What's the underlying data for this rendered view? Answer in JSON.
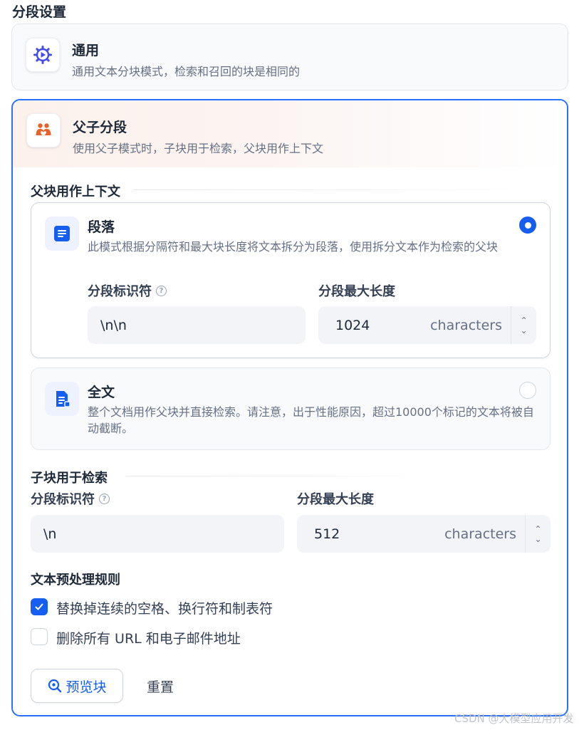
{
  "page": {
    "section_title": "分段设置"
  },
  "general": {
    "title": "通用",
    "desc": "通用文本分块模式，检索和召回的块是相同的",
    "icon": "gear-play-icon",
    "icon_color": "#444ce7"
  },
  "parent_child": {
    "title": "父子分段",
    "desc": "使用父子模式时，子块用于检索，父块用作上下文",
    "icon": "family-icon",
    "icon_color": "#e8622c",
    "border_color": "#2970ff",
    "parent_section": {
      "title": "父块用作上下文",
      "paragraph": {
        "title": "段落",
        "desc": "此模式根据分隔符和最大块长度将文本拆分为段落，使用拆分文本作为检索的父块",
        "selected": true,
        "delimiter_label": "分段标识符",
        "delimiter_value": "\\n\\n",
        "maxlen_label": "分段最大长度",
        "maxlen_value": "1024",
        "maxlen_unit": "characters"
      },
      "full_doc": {
        "title": "全文",
        "desc": "整个文档用作父块并直接检索。请注意，出于性能原因，超过10000个标记的文本将被自动截断。",
        "selected": false
      }
    },
    "child_section": {
      "title": "子块用于检索",
      "delimiter_label": "分段标识符",
      "delimiter_value": "\\n",
      "maxlen_label": "分段最大长度",
      "maxlen_value": "512",
      "maxlen_unit": "characters"
    },
    "preprocess": {
      "title": "文本预处理规则",
      "rules": [
        {
          "label": "替换掉连续的空格、换行符和制表符",
          "checked": true
        },
        {
          "label": "删除所有 URL 和电子邮件地址",
          "checked": false
        }
      ]
    },
    "actions": {
      "preview_label": "预览块",
      "reset_label": "重置"
    }
  },
  "watermark": "CSDN @大模型应用开发",
  "colors": {
    "accent": "#155eef",
    "input_bg": "#f2f4f7"
  }
}
